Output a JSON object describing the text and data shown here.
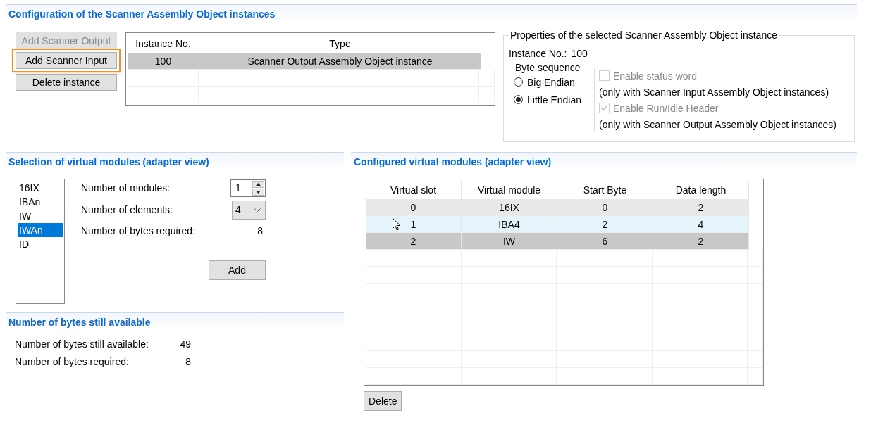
{
  "instances_section": {
    "title": "Configuration of the Scanner Assembly Object instances",
    "buttons": [
      {
        "label": "Add Scanner Output",
        "disabled": true,
        "highlighted": false
      },
      {
        "label": "Add Scanner Input",
        "disabled": false,
        "highlighted": true
      },
      {
        "label": "Delete instance",
        "disabled": false,
        "highlighted": false
      }
    ],
    "table": {
      "columns": [
        "Instance No.",
        "Type"
      ],
      "rows": [
        {
          "cells": [
            "100",
            "Scanner Output Assembly Object instance"
          ],
          "selected": true
        }
      ]
    },
    "properties": {
      "title": "Properties of the selected Scanner Assembly Object instance",
      "instance_label": "Instance No.:",
      "instance_value": "100",
      "byte_sequence": {
        "title": "Byte sequence",
        "options": [
          {
            "label": "Big Endian",
            "selected": false
          },
          {
            "label": "Little Endian",
            "selected": true
          }
        ]
      },
      "options": [
        {
          "label": "Enable status word",
          "checked": false,
          "disabled": true,
          "note": "(only with Scanner Input Assembly Object instances)"
        },
        {
          "label": "Enable Run/Idle Header",
          "checked": true,
          "disabled": true,
          "note": "(only with Scanner Output Assembly Object instances)"
        }
      ]
    }
  },
  "selection_section": {
    "title": "Selection of virtual modules (adapter view)",
    "modules": [
      {
        "label": "16IX",
        "selected": false
      },
      {
        "label": "IBAn",
        "selected": false
      },
      {
        "label": "IW",
        "selected": false
      },
      {
        "label": "IWAn",
        "selected": true
      },
      {
        "label": "ID",
        "selected": false
      }
    ],
    "modules_label": "Number of modules:",
    "modules_value": "1",
    "elements_label": "Number of elements:",
    "elements_value": "4",
    "bytes_label": "Number of bytes required:",
    "bytes_value": "8",
    "add_button": "Add"
  },
  "bytes_section": {
    "title": "Number of bytes still available",
    "rows": [
      {
        "label": "Number of bytes still available:",
        "value": "49"
      },
      {
        "label": "Number of bytes required:",
        "value": "8"
      }
    ]
  },
  "configured_section": {
    "title": "Configured virtual modules (adapter view)",
    "columns": [
      "Virtual slot",
      "Virtual module",
      "Start Byte",
      "Data length"
    ],
    "rows": [
      {
        "cells": [
          "0",
          "16IX",
          "0",
          "2"
        ],
        "selected": false,
        "focused": true,
        "hovered": false
      },
      {
        "cells": [
          "1",
          "IBA4",
          "2",
          "4"
        ],
        "selected": false,
        "focused": false,
        "hovered": true
      },
      {
        "cells": [
          "2",
          "IW",
          "6",
          "2"
        ],
        "selected": true,
        "focused": false,
        "hovered": false
      }
    ],
    "delete_button": "Delete"
  }
}
